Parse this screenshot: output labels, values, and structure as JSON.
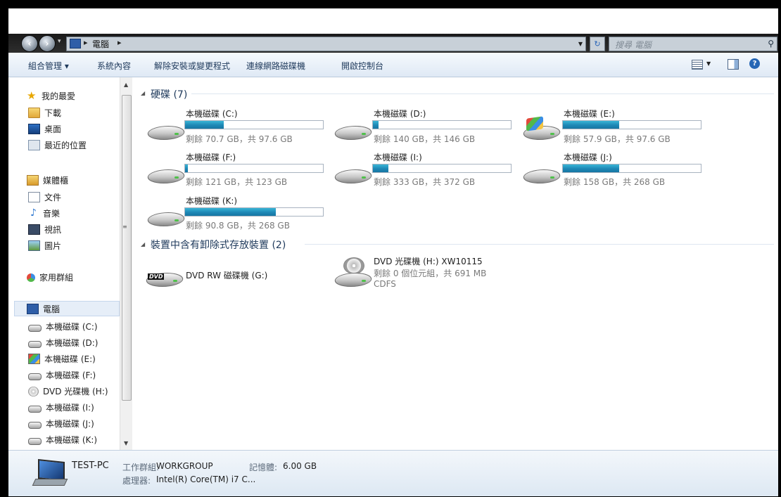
{
  "addressbar": {
    "breadcrumb": "電腦",
    "search_placeholder": "搜尋 電腦"
  },
  "toolbar": {
    "organize": "組合管理 ▾",
    "properties": "系統內容",
    "uninstall": "解除安裝或變更程式",
    "map_drive": "連線網路磁碟機",
    "control_panel": "開啟控制台"
  },
  "sidebar": {
    "favorites": [
      {
        "label": "我的最愛",
        "icon": "star-icon"
      },
      {
        "label": "下載",
        "icon": "folder-icon"
      },
      {
        "label": "桌面",
        "icon": "desktop-icon"
      },
      {
        "label": "最近的位置",
        "icon": "recent-icon"
      }
    ],
    "libraries": [
      {
        "label": "媒體櫃",
        "icon": "library-icon"
      },
      {
        "label": "文件",
        "icon": "document-icon"
      },
      {
        "label": "音樂",
        "icon": "music-icon"
      },
      {
        "label": "視訊",
        "icon": "video-icon"
      },
      {
        "label": "圖片",
        "icon": "picture-icon"
      }
    ],
    "homegroup": "家用群組",
    "computer": "電腦",
    "drives": [
      {
        "label": "本機磁碟 (C:)",
        "icon": "drive-icon"
      },
      {
        "label": "本機磁碟 (D:)",
        "icon": "drive-icon"
      },
      {
        "label": "本機磁碟 (E:)",
        "icon": "windows-drive-icon"
      },
      {
        "label": "本機磁碟 (F:)",
        "icon": "drive-icon"
      },
      {
        "label": "DVD 光碟機 (H:)",
        "icon": "dvd-icon"
      },
      {
        "label": "本機磁碟 (I:)",
        "icon": "drive-icon"
      },
      {
        "label": "本機磁碟 (J:)",
        "icon": "drive-icon"
      },
      {
        "label": "本機磁碟 (K:)",
        "icon": "drive-icon"
      }
    ]
  },
  "content": {
    "hard_disks_title": "硬碟 (7)",
    "removable_title": "裝置中含有卸除式存放裝置 (2)",
    "drives": [
      {
        "name": "本機磁碟 (C:)",
        "space": "剩餘 70.7 GB，共 97.6 GB",
        "used_fraction": 0.28
      },
      {
        "name": "本機磁碟 (D:)",
        "space": "剩餘 140 GB，共 146 GB",
        "used_fraction": 0.04
      },
      {
        "name": "本機磁碟 (E:)",
        "space": "剩餘 57.9 GB，共 97.6 GB",
        "used_fraction": 0.41
      },
      {
        "name": "本機磁碟 (F:)",
        "space": "剩餘 121 GB，共 123 GB",
        "used_fraction": 0.02
      },
      {
        "name": "本機磁碟 (I:)",
        "space": "剩餘 333 GB，共 372 GB",
        "used_fraction": 0.11
      },
      {
        "name": "本機磁碟 (J:)",
        "space": "剩餘 158 GB，共 268 GB",
        "used_fraction": 0.41
      },
      {
        "name": "本機磁碟 (K:)",
        "space": "剩餘 90.8 GB，共 268 GB",
        "used_fraction": 0.66
      }
    ],
    "dvd_g": {
      "name": "DVD RW 磁碟機 (G:)"
    },
    "dvd_h": {
      "name": "DVD 光碟機 (H:) XW10115",
      "space": "剩餘 0 個位元組，共 691 MB",
      "fs": "CDFS"
    }
  },
  "details": {
    "pc_name": "TEST-PC",
    "workgroup_label": "工作群組:",
    "workgroup_value": "WORKGROUP",
    "memory_label": "記憶體:",
    "memory_value": "6.00 GB",
    "processor_label": "處理器:",
    "processor_value": "Intel(R) Core(TM) i7 C..."
  },
  "colors": {
    "bar_fill": "#1e87b5",
    "section_title": "#1e395b"
  }
}
